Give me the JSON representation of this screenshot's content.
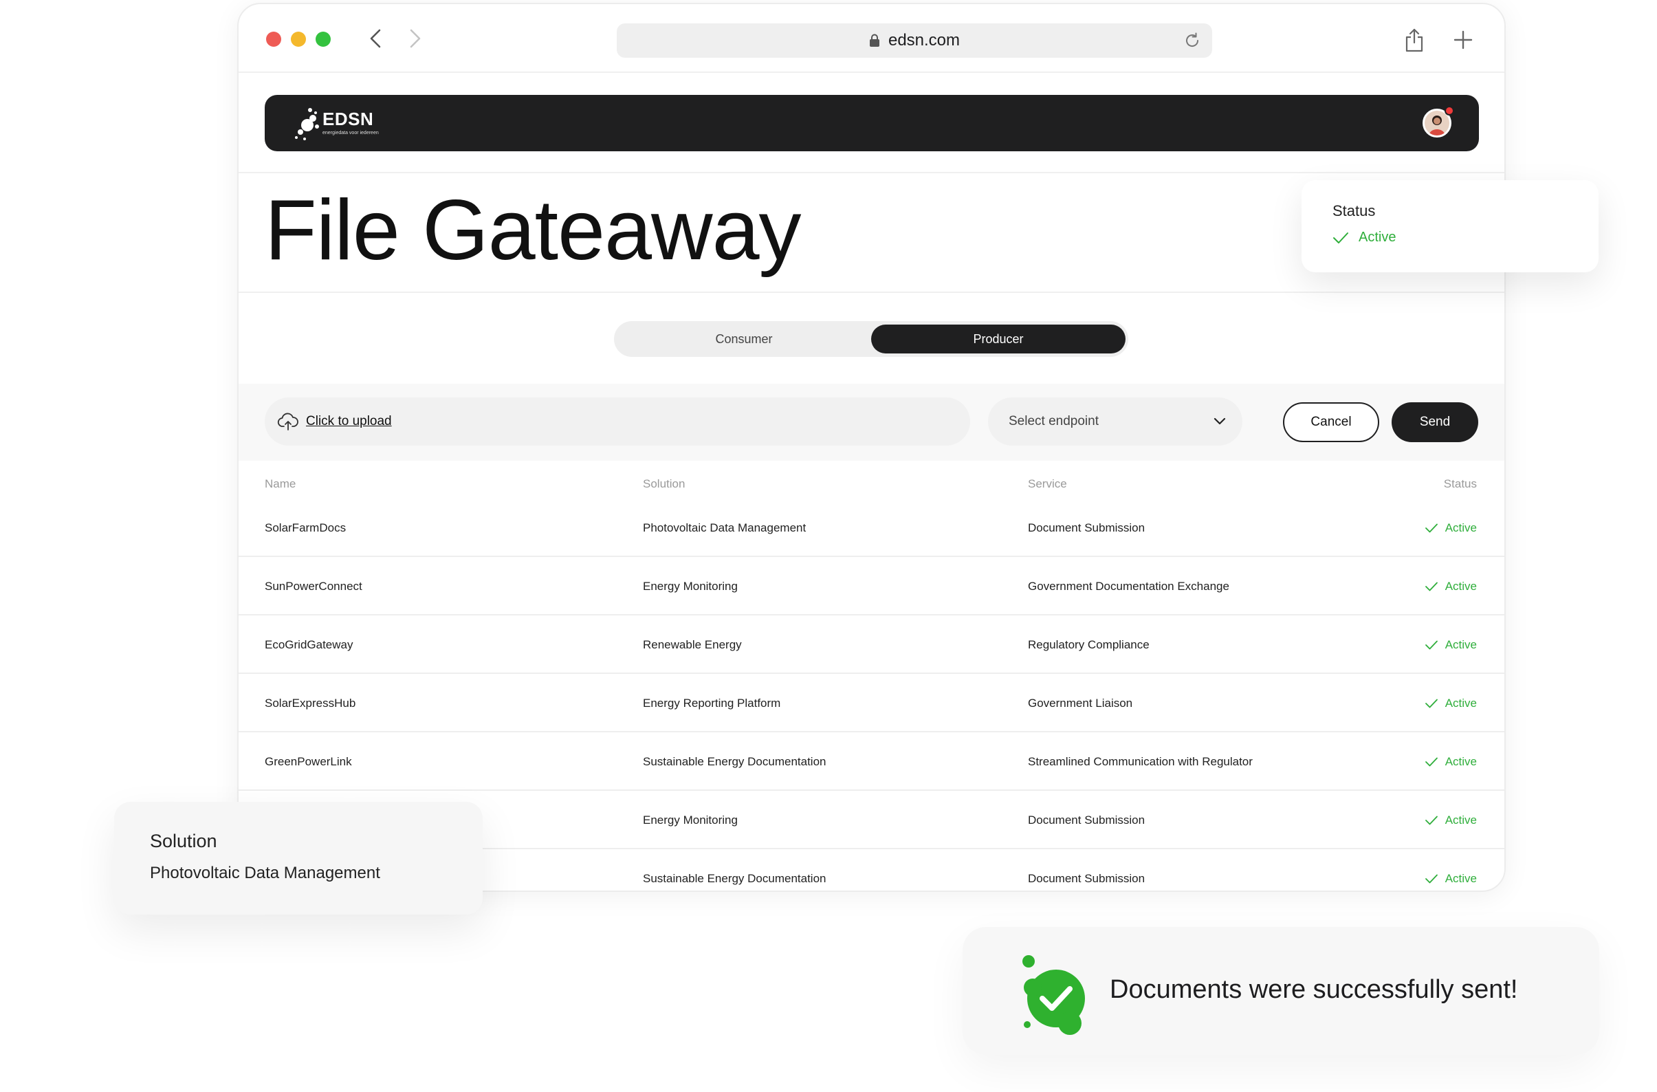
{
  "browser": {
    "url": "edsn.com"
  },
  "header": {
    "logo_text": "EDSN",
    "logo_tagline": "energiedata voor iedereen"
  },
  "page": {
    "title": "File Gateaway"
  },
  "toggle": {
    "consumer_label": "Consumer",
    "producer_label": "Producer",
    "selected": "Producer"
  },
  "upload": {
    "upload_label": "Click to upload",
    "select_placeholder": "Select endpoint",
    "cancel_label": "Cancel",
    "send_label": "Send"
  },
  "table": {
    "headers": {
      "name": "Name",
      "solution": "Solution",
      "service": "Service",
      "status": "Status"
    },
    "rows": [
      {
        "name": "SolarFarmDocs",
        "solution": "Photovoltaic Data Management",
        "service": "Document Submission",
        "status": "Active"
      },
      {
        "name": "SunPowerConnect",
        "solution": "Energy Monitoring",
        "service": "Government Documentation Exchange",
        "status": "Active"
      },
      {
        "name": "EcoGridGateway",
        "solution": "Renewable Energy",
        "service": "Regulatory Compliance",
        "status": "Active"
      },
      {
        "name": "SolarExpressHub",
        "solution": "Energy Reporting Platform",
        "service": "Government Liaison",
        "status": "Active"
      },
      {
        "name": "GreenPowerLink",
        "solution": "Sustainable Energy Documentation",
        "service": "Streamlined Communication with Regulator",
        "status": "Active"
      },
      {
        "name": "",
        "solution": "Energy Monitoring",
        "service": "Document Submission",
        "status": "Active"
      },
      {
        "name": "",
        "solution": "Sustainable Energy Documentation",
        "service": "Document Submission",
        "status": "Active"
      }
    ]
  },
  "status_card": {
    "label": "Status",
    "value": "Active"
  },
  "solution_card": {
    "label": "Solution",
    "value": "Photovoltaic Data Management"
  },
  "toast": {
    "message": "Documents were successfully sent!"
  },
  "colors": {
    "accent_green": "#2fae3b",
    "dark": "#1f1f20",
    "traffic_red": "#ee5b55",
    "traffic_yellow": "#f4b82c",
    "traffic_green": "#34c23f"
  }
}
